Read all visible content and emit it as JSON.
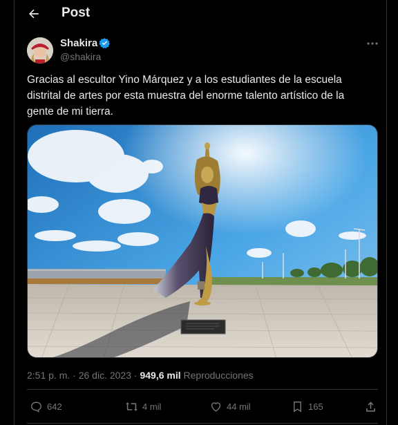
{
  "header": {
    "title": "Post"
  },
  "author": {
    "name": "Shakira",
    "handle": "@shakira"
  },
  "tweet": {
    "lines": [
      "Gracias al escultor Yino Márquez y a los estudiantes de la escuela",
      "distrital de artes por esta muestra del enorme talento artístico de la",
      "gente de mi tierra."
    ]
  },
  "meta": {
    "time": "2:51 p. m.",
    "sep": " · ",
    "date": "26 dic. 2023",
    "sep2": " · ",
    "views": "949,6 mil",
    "views_label": " Reproducciones"
  },
  "actions": {
    "replies": "642",
    "reposts": "4 mil",
    "likes": "44 mil",
    "bookmarks": "165"
  },
  "colors": {
    "accent": "#1d9bf0",
    "muted": "#71767b",
    "text": "#e7e9ea",
    "border": "#2f3336"
  }
}
